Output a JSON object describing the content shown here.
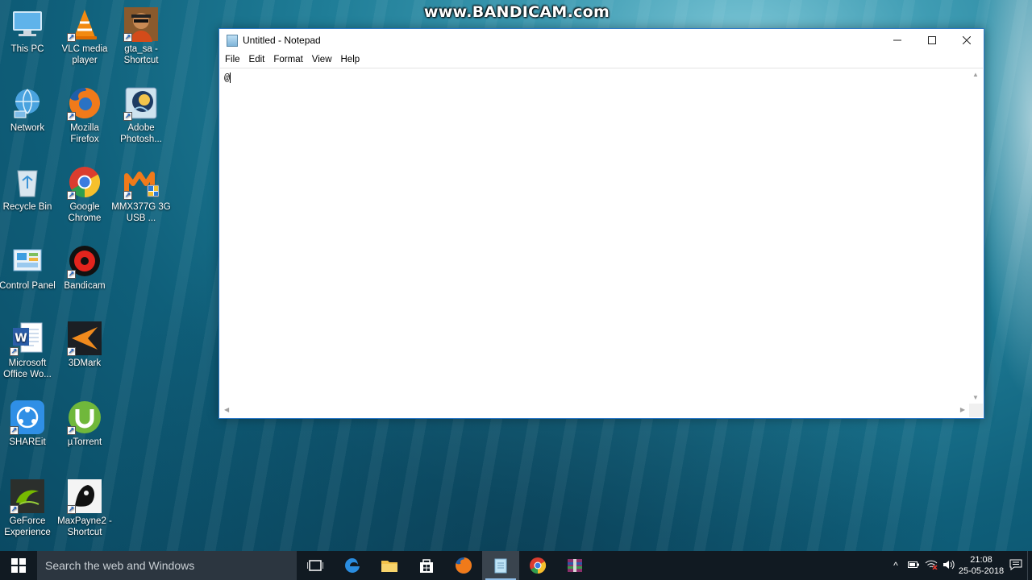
{
  "watermark": "www.BANDICAM.com",
  "desktop": {
    "icons": [
      {
        "label": "This PC",
        "icon": "this-pc-icon"
      },
      {
        "label": "VLC media player",
        "icon": "vlc-icon"
      },
      {
        "label": "gta_sa - Shortcut",
        "icon": "gta-icon"
      },
      {
        "label": "Network",
        "icon": "network-icon"
      },
      {
        "label": "Mozilla Firefox",
        "icon": "firefox-icon"
      },
      {
        "label": "Adobe Photosh...",
        "icon": "photoshop-icon"
      },
      {
        "label": "Recycle Bin",
        "icon": "recycle-bin-icon"
      },
      {
        "label": "Google Chrome",
        "icon": "chrome-icon"
      },
      {
        "label": "MMX377G 3G USB ...",
        "icon": "micromax-icon"
      },
      {
        "label": "Control Panel",
        "icon": "control-panel-icon"
      },
      {
        "label": "Bandicam",
        "icon": "bandicam-icon"
      },
      {
        "label": "Microsoft Office Wo...",
        "icon": "word-icon"
      },
      {
        "label": "3DMark",
        "icon": "3dmark-icon"
      },
      {
        "label": "SHAREit",
        "icon": "shareit-icon"
      },
      {
        "label": "µTorrent",
        "icon": "utorrent-icon"
      },
      {
        "label": "GeForce Experience",
        "icon": "geforce-icon"
      },
      {
        "label": "MaxPayne2 - Shortcut",
        "icon": "maxpayne-icon"
      }
    ]
  },
  "notepad": {
    "title": "Untitled - Notepad",
    "menu": [
      "File",
      "Edit",
      "Format",
      "View",
      "Help"
    ],
    "content": "@"
  },
  "taskbar": {
    "search_placeholder": "Search the web and Windows",
    "apps": [
      "task-view-icon",
      "edge-icon",
      "file-explorer-icon",
      "store-icon",
      "firefox-icon",
      "notepad-icon",
      "chrome-icon",
      "winrar-icon"
    ],
    "time": "21:08",
    "date": "25-05-2018"
  },
  "colors": {
    "taskbar": "#111a22",
    "window_border": "#2b78c7",
    "accent": "#8fbce6"
  }
}
